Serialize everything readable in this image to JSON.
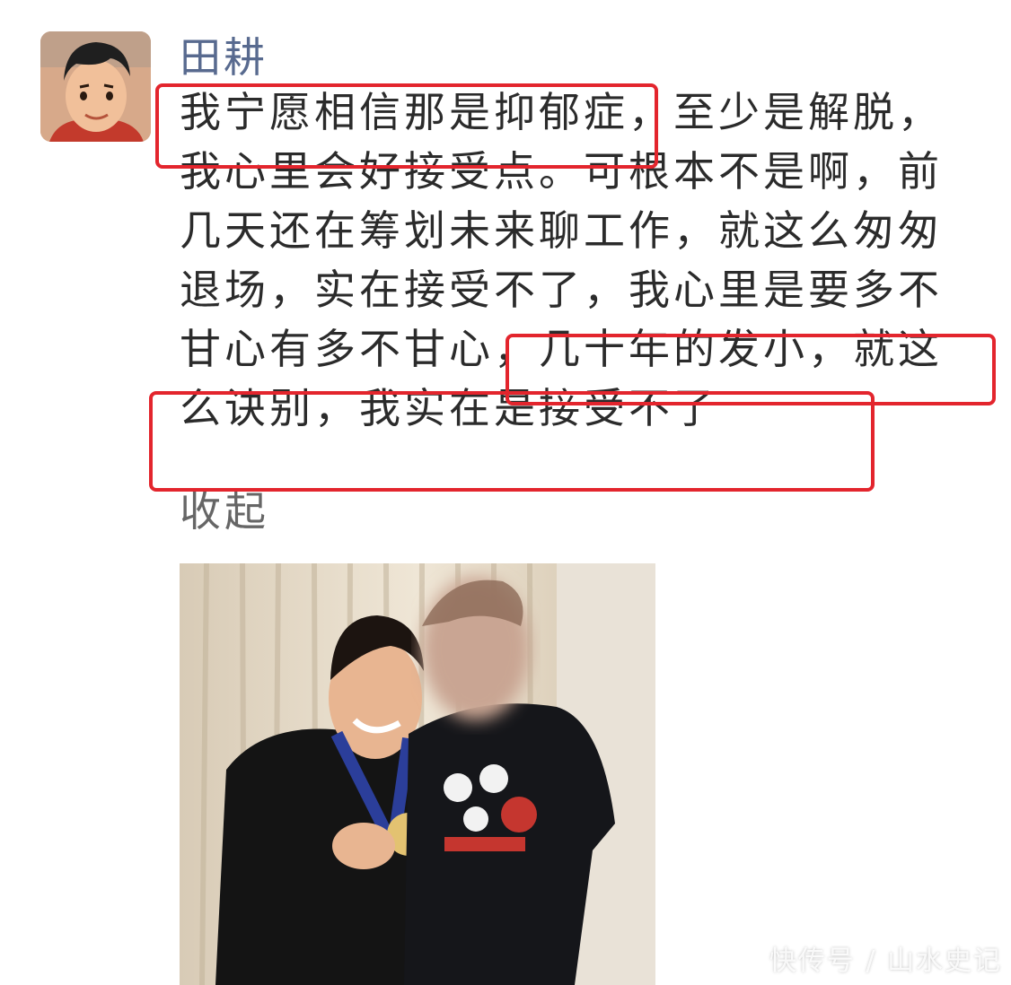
{
  "post": {
    "author": "田耕",
    "lines": [
      "我宁愿相信那是抑郁症，至少是解脱，",
      "我心里会好接受点。可根本不是啊，前",
      "几天还在筹划未来聊工作，就这么匆匆",
      "退场，实在接受不了，我心里是要多不",
      "甘心有多不甘心，几十年的发小，就这",
      "么诀别，我实在是接受不了"
    ],
    "collapse_label": "收起"
  },
  "watermark": "快传号 / 山水史记",
  "highlight_color": "#e3252d",
  "link_color": "#586a8f"
}
